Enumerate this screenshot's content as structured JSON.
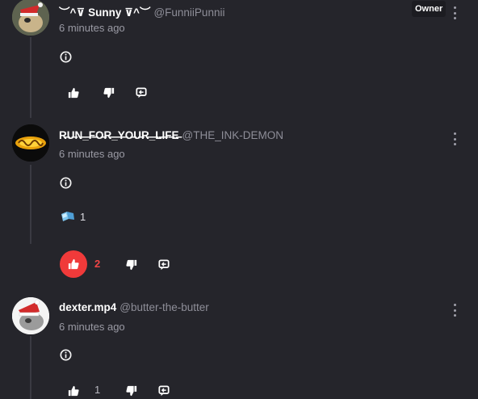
{
  "posts": [
    {
      "display_name": "︶^⊽ Sunny ⊽^︶",
      "handle": "@FunniiPunnii",
      "badge": "Owner",
      "timestamp": "6 minutes ago",
      "likes": "",
      "reaction": null
    },
    {
      "display_name": "R̶U̶N̶_̶F̶O̶R̶_̶Y̶O̶U̶R̶_̶L̶I̶F̶E̶",
      "handle": "@THE_INK-DEMON",
      "badge": "",
      "timestamp": "6 minutes ago",
      "likes": "2",
      "reaction": {
        "count": "1"
      }
    },
    {
      "display_name": "dexter.mp4",
      "handle": "@butter-the-butter",
      "badge": "",
      "timestamp": "6 minutes ago",
      "likes": "1",
      "reaction": null
    }
  ],
  "colors": {
    "background": "#25252b",
    "liked_accent": "#f03a3a",
    "text_muted": "#9a9aa4"
  },
  "icons": [
    "info-icon",
    "thumbs-up-icon",
    "thumbs-down-icon",
    "reply-icon",
    "kebab-menu-icon",
    "ice-cube-emoji"
  ]
}
